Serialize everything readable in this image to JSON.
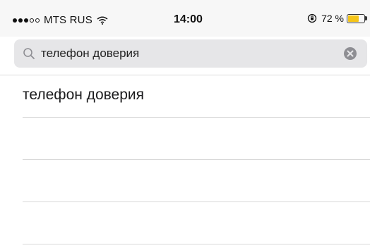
{
  "status_bar": {
    "signal_dots": [
      "filled",
      "filled",
      "filled",
      "empty",
      "empty"
    ],
    "carrier": "MTS RUS",
    "wifi_icon": "wifi-icon",
    "time": "14:00",
    "orientation_lock_icon": "orientation-lock-icon",
    "battery_percent": "72 %",
    "battery_level": 0.72,
    "battery_color": "#f5c518"
  },
  "search": {
    "query": "телефон доверия",
    "search_icon": "search-icon",
    "clear_icon": "clear-icon"
  },
  "results": [
    {
      "label": "телефон доверия"
    },
    {
      "label": ""
    },
    {
      "label": ""
    },
    {
      "label": ""
    }
  ]
}
